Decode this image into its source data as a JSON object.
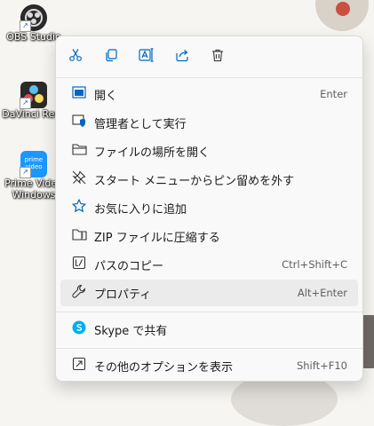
{
  "desktop": {
    "icons": [
      {
        "label": "OBS Studio",
        "name": "obs"
      },
      {
        "label": "DaVinci Reso",
        "name": "davinci"
      },
      {
        "label": "Prime Video",
        "label2": "Windows",
        "name": "prime",
        "badge": "prime video"
      }
    ]
  },
  "menu": {
    "quick_actions": [
      {
        "name": "cut-icon"
      },
      {
        "name": "copy-icon"
      },
      {
        "name": "rename-icon"
      },
      {
        "name": "share-icon"
      },
      {
        "name": "delete-icon"
      }
    ],
    "items": [
      {
        "label": "開く",
        "shortcut": "Enter"
      },
      {
        "label": "管理者として実行",
        "shortcut": ""
      },
      {
        "label": "ファイルの場所を開く",
        "shortcut": ""
      },
      {
        "label": "スタート メニューからピン留めを外す",
        "shortcut": ""
      },
      {
        "label": "お気に入りに追加",
        "shortcut": ""
      },
      {
        "label": "ZIP ファイルに圧縮する",
        "shortcut": ""
      },
      {
        "label": "パスのコピー",
        "shortcut": "Ctrl+Shift+C"
      },
      {
        "label": "プロパティ",
        "shortcut": "Alt+Enter"
      },
      {
        "label": "Skype で共有",
        "shortcut": ""
      },
      {
        "label": "その他のオプションを表示",
        "shortcut": "Shift+F10"
      }
    ]
  },
  "colors": {
    "accent": "#0067c0",
    "skype": "#00aff0"
  }
}
